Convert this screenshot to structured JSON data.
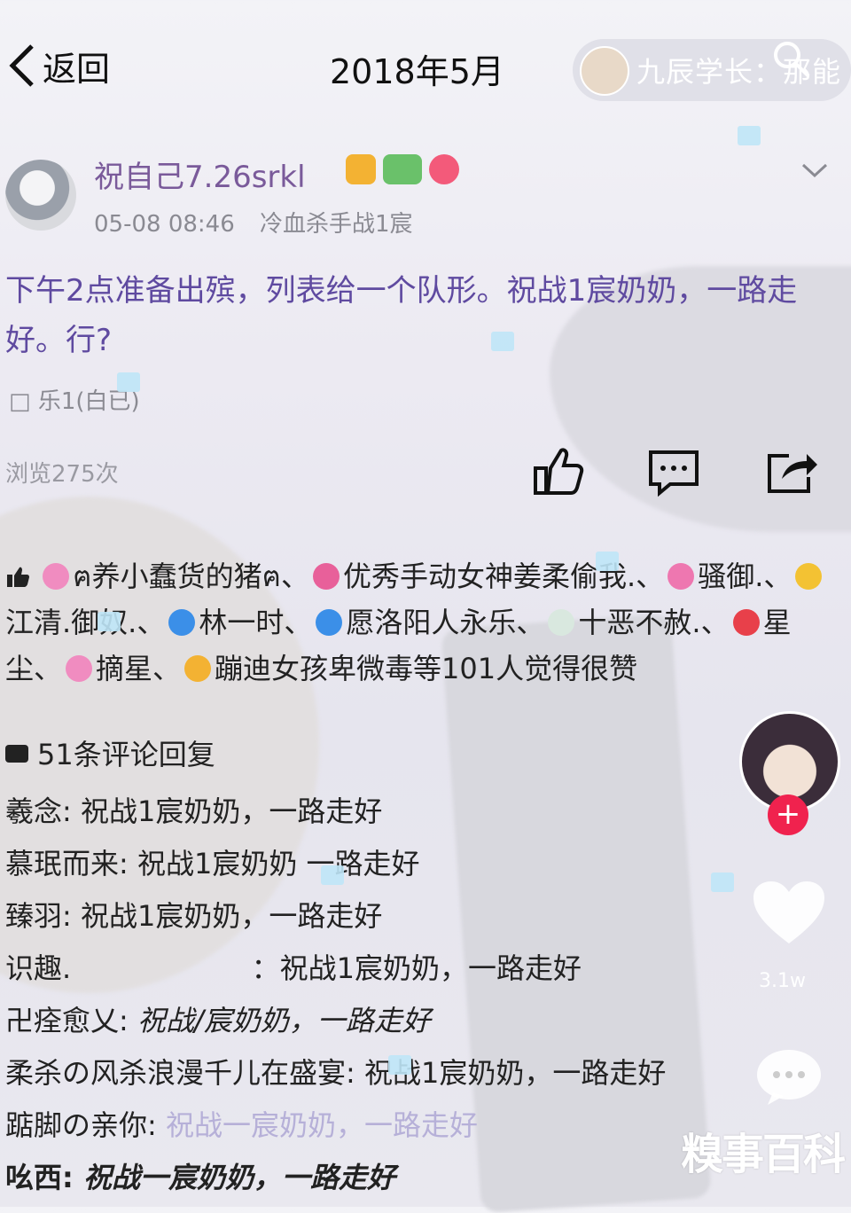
{
  "topbar": {
    "back_label": "返回",
    "title": "2018年5月",
    "pill_text": "九辰学长：那能"
  },
  "post": {
    "username": "祝自己7.26srkl",
    "time": "05-08 08:46",
    "group": "冷血杀手战1宸",
    "content": "下午2点准备出殡，列表给一个队形。祝战1宸奶奶，一路走好。行?",
    "location": "乐1(白已)",
    "views": "浏览275次"
  },
  "likes": {
    "text_parts": [
      "ฅ养小蠢货的猪ฅ、",
      "优秀手动女神姜柔偷我.、",
      "骚御.、",
      "江清.御奴.、",
      "林一时、",
      "愿洛阳人永乐、",
      "十恶不赦.、",
      "星尘、",
      "摘星、",
      "蹦迪女孩卑微毒等101人觉得很赞"
    ],
    "icon_colors": [
      "#f08cc0",
      "#e8609a",
      "#ee77b0",
      "#f3c233",
      "#3b8fe8",
      "#3b8fe8",
      "#d9e8df",
      "#e8404a",
      "#f08cc0",
      "#f3b233"
    ]
  },
  "comments_header": "51条评论回复",
  "comments": [
    {
      "name": "羲念: ",
      "text": "祝战1宸奶奶，一路走好"
    },
    {
      "name": "慕珉而来: ",
      "text": "祝战1宸奶奶  一路走好"
    },
    {
      "name": "臻羽: ",
      "text": "祝战1宸奶奶，一路走好"
    },
    {
      "name": "识趣.",
      "text": "                    ：祝战1宸奶奶，一路走好"
    },
    {
      "name": "卍痊愈乂: ",
      "text": "祝战/宸奶奶，一路走好"
    },
    {
      "name": "柔杀の风杀浪漫千儿在盛宴: ",
      "text": "祝战1宸奶奶，一路走好"
    },
    {
      "name": "踮脚の亲你: ",
      "text": "祝战一宸奶奶，一路走好"
    },
    {
      "name": "吆西: ",
      "text": "祝战一宸奶奶，一路走好"
    }
  ],
  "side": {
    "like_count": "3.1w",
    "follow_symbol": "+"
  },
  "watermark": "糗事百科",
  "icons": [
    "back-chevron-icon",
    "search-icon",
    "chevron-down-icon",
    "like-icon",
    "comment-icon",
    "share-icon",
    "heart-icon",
    "chat-icon"
  ]
}
